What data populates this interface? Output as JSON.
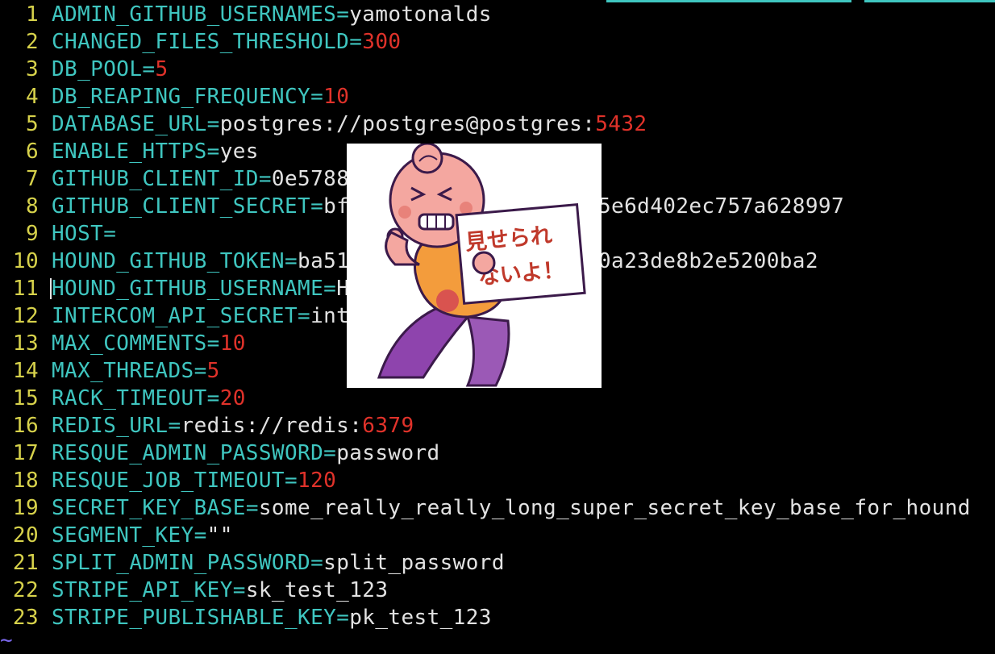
{
  "editor": {
    "lines": [
      {
        "n": "1",
        "key": "ADMIN_GITHUB_USERNAMES",
        "val": "yamotonalds",
        "type": "str"
      },
      {
        "n": "2",
        "key": "CHANGED_FILES_THRESHOLD",
        "val": "300",
        "type": "num"
      },
      {
        "n": "3",
        "key": "DB_POOL",
        "val": "5",
        "type": "num"
      },
      {
        "n": "4",
        "key": "DB_REAPING_FREQUENCY",
        "val": "10",
        "type": "num"
      },
      {
        "n": "5",
        "key": "DATABASE_URL",
        "val": "postgres://postgres@postgres:",
        "val2": "5432",
        "type": "mixed"
      },
      {
        "n": "6",
        "key": "ENABLE_HTTPS",
        "val": "yes",
        "type": "str"
      },
      {
        "n": "7",
        "key": "GITHUB_CLIENT_ID",
        "val": "0e5788",
        "type": "str"
      },
      {
        "n": "8",
        "key": "GITHUB_CLIENT_SECRET",
        "val": "bf",
        "tail": "5e6d402ec757a628997",
        "type": "split"
      },
      {
        "n": "9",
        "key": "HOST",
        "val": "",
        "type": "str"
      },
      {
        "n": "10",
        "key": "HOUND_GITHUB_TOKEN",
        "val": "ba51",
        "tail": "0a23de8b2e5200ba2",
        "type": "split"
      },
      {
        "n": "11",
        "key": "HOUND_GITHUB_USERNAME",
        "val": "H",
        "type": "str"
      },
      {
        "n": "12",
        "key": "INTERCOM_API_SECRET",
        "val": "int",
        "type": "str"
      },
      {
        "n": "13",
        "key": "MAX_COMMENTS",
        "val": "10",
        "type": "num"
      },
      {
        "n": "14",
        "key": "MAX_THREADS",
        "val": "5",
        "type": "num"
      },
      {
        "n": "15",
        "key": "RACK_TIMEOUT",
        "val": "20",
        "type": "num"
      },
      {
        "n": "16",
        "key": "REDIS_URL",
        "val": "redis://redis:",
        "val2": "6379",
        "type": "mixed"
      },
      {
        "n": "17",
        "key": "RESQUE_ADMIN_PASSWORD",
        "val": "password",
        "type": "str"
      },
      {
        "n": "18",
        "key": "RESQUE_JOB_TIMEOUT",
        "val": "120",
        "type": "num"
      },
      {
        "n": "19",
        "key": "SECRET_KEY_BASE",
        "val": "some_really_really_long_super_secret_key_base_for_hound",
        "type": "str"
      },
      {
        "n": "20",
        "key": "SEGMENT_KEY",
        "val": "\"\"",
        "type": "str"
      },
      {
        "n": "21",
        "key": "SPLIT_ADMIN_PASSWORD",
        "val": "split_password",
        "type": "str"
      },
      {
        "n": "22",
        "key": "STRIPE_API_KEY",
        "val": "sk_test_123",
        "type": "str"
      },
      {
        "n": "23",
        "key": "STRIPE_PUBLISHABLE_KEY",
        "val": "pk_test_123",
        "type": "str"
      }
    ],
    "eq": "=",
    "tilde": "~",
    "cursor_line": "11"
  },
  "sticker": {
    "sign_line1": "見せられ",
    "sign_line2": "ないよ！",
    "icon": "censor-sticker-character"
  },
  "colors": {
    "background": "#000000",
    "line_number": "#d7d24b",
    "key": "#3fc6c0",
    "value": "#e2e2e2",
    "number": "#e0322a",
    "tilde": "#7b68ee"
  }
}
